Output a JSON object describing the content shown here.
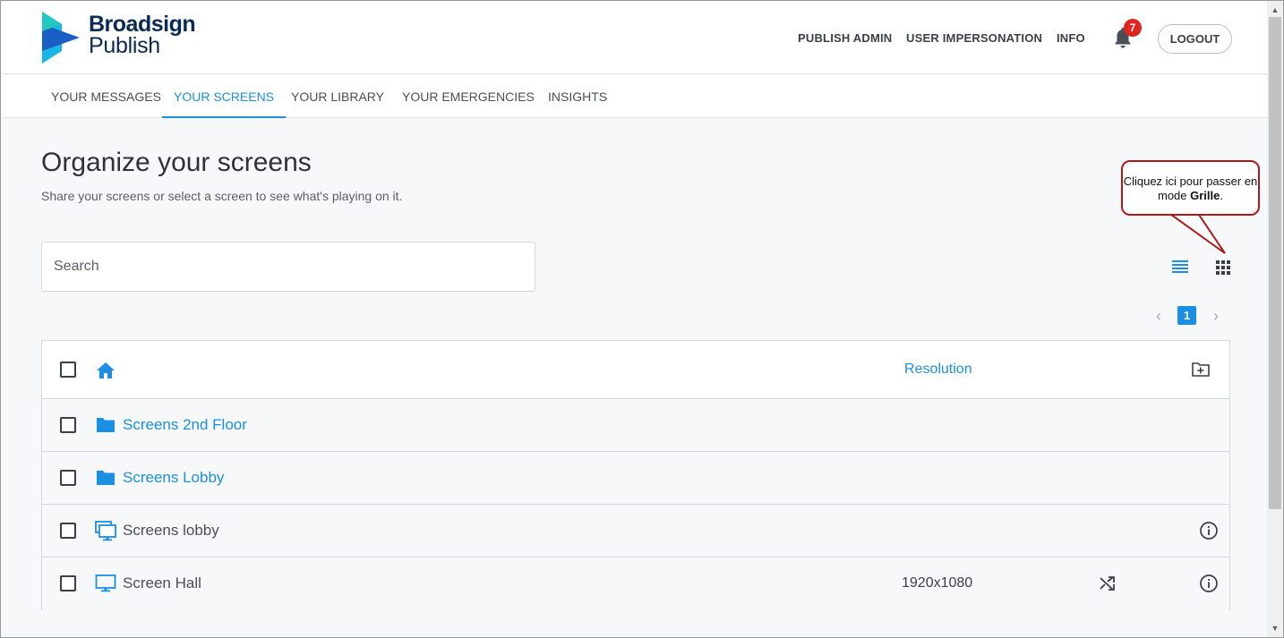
{
  "header": {
    "logo_line1": "Broadsign",
    "logo_line2": "Publish",
    "nav": [
      "PUBLISH ADMIN",
      "USER IMPERSONATION",
      "INFO"
    ],
    "notification_count": "7",
    "logout_label": "LOGOUT"
  },
  "tabs": [
    "YOUR MESSAGES",
    "YOUR SCREENS",
    "YOUR LIBRARY",
    "YOUR EMERGENCIES",
    "INSIGHTS"
  ],
  "active_tab": "YOUR SCREENS",
  "page": {
    "title": "Organize your screens",
    "subtitle": "Share your screens or select a screen to see what's playing on it.",
    "search_placeholder": "Search"
  },
  "callout": {
    "text_before": "Cliquez ici pour passer en mode ",
    "text_bold": "Grille",
    "text_after": "."
  },
  "pagination": {
    "current_page": "1",
    "prev": "‹",
    "next": "›"
  },
  "table": {
    "resolution_header": "Resolution",
    "rows": [
      {
        "type": "folder",
        "label": "Screens 2nd Floor",
        "resolution": ""
      },
      {
        "type": "folder",
        "label": "Screens Lobby",
        "resolution": ""
      },
      {
        "type": "screen-group",
        "label": "Screens lobby",
        "resolution": ""
      },
      {
        "type": "screen",
        "label": "Screen Hall",
        "resolution": "1920x1080"
      }
    ]
  },
  "colors": {
    "accent": "#1a8fe3",
    "badge": "#e0241f",
    "callout_border": "#b01818",
    "logo_cyan": "#19b7e6",
    "logo_blue": "#1a5fc4",
    "logo_text": "#0a2a55"
  },
  "scrollbar": {
    "up_glyph": "▲",
    "down_glyph": "▼"
  }
}
